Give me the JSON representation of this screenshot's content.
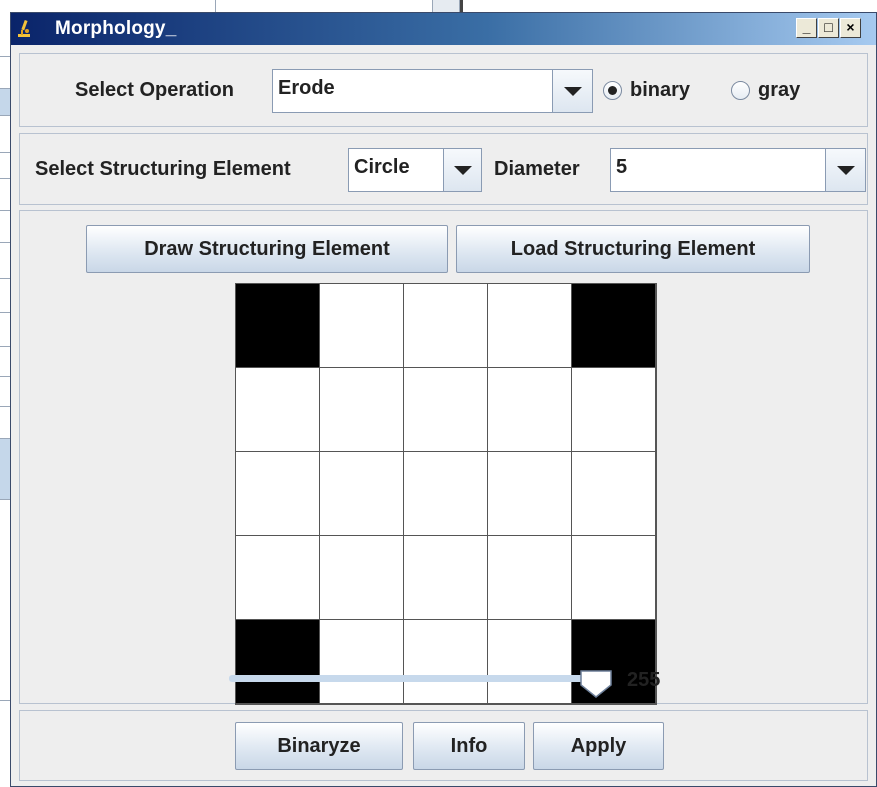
{
  "window": {
    "title": "Morphology_",
    "minimize_label": "_",
    "maximize_label": "□",
    "close_label": "×"
  },
  "operation": {
    "label": "Select Operation",
    "selected": "Erode",
    "mode_options": [
      {
        "label": "binary",
        "selected": true
      },
      {
        "label": "gray",
        "selected": false
      }
    ]
  },
  "structuring": {
    "label": "Select Structuring Element",
    "shape": "Circle",
    "diameter_label": "Diameter",
    "diameter": "5"
  },
  "element_panel": {
    "draw_label": "Draw Structuring Element",
    "load_label": "Load Structuring Element",
    "grid": [
      [
        1,
        0,
        0,
        0,
        1
      ],
      [
        0,
        0,
        0,
        0,
        0
      ],
      [
        0,
        0,
        0,
        0,
        0
      ],
      [
        0,
        0,
        0,
        0,
        0
      ],
      [
        1,
        0,
        0,
        0,
        1
      ]
    ],
    "slider_value": "255",
    "slider_fraction": 0.98
  },
  "actions": {
    "binaryze_label": "Binaryze",
    "info_label": "Info",
    "apply_label": "Apply"
  },
  "colors": {
    "title_bar": "#0a246a",
    "panel_bg": "#eeeeee",
    "slider_track": "#c7d9ec"
  }
}
